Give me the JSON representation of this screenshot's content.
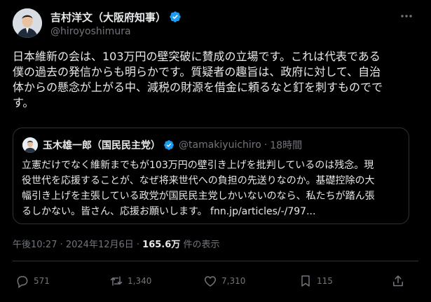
{
  "author": {
    "display_name": "吉村洋文（大阪府知事）",
    "handle": "@hiroyoshimura"
  },
  "tweet": {
    "text": "日本維新の会は、103万円の壁突破に賛成の立場です。これは代表である\n僕の過去の発信からも明らかです。質疑者の趣旨は、政府に対して、自治\n体からの懸念が上がる中、減税の財源を借金に頼るなと釘を刺すものでで\nす。"
  },
  "quote": {
    "display_name": "玉木雄一郎（国民民主党）",
    "handle": "@tamakiyuichiro",
    "separator": "·",
    "time": "18時間",
    "text": "立憲だけでなく維新までもが103万円の壁引き上げを批判しているのは残念。現\n役世代を応援することが、なぜ将来世代への負担の先送りなのか。基礎控除の大\n幅引き上げを主張している政党が国民民主党しかいないのなら、私たちが踏ん張\nるしかない。皆さん、応援お願いします。 fnn.jp/articles/-/797..."
  },
  "meta": {
    "timestamp": "午後10:27 · 2024年12月6日 ·",
    "views_count": "165.6万",
    "views_label": "件の表示"
  },
  "actions": {
    "reply_count": "571",
    "repost_count": "1,340",
    "like_count": "7,310",
    "bookmark_count": "115"
  },
  "colors": {
    "background": "#000000",
    "verified": "#1d9bf0",
    "text": "#e7e9ea",
    "muted": "#71767b",
    "border": "#2f3336"
  },
  "icons": [
    "verified-badge-icon",
    "more-options-icon",
    "reply-icon",
    "repost-icon",
    "like-icon",
    "bookmark-icon",
    "share-icon"
  ]
}
